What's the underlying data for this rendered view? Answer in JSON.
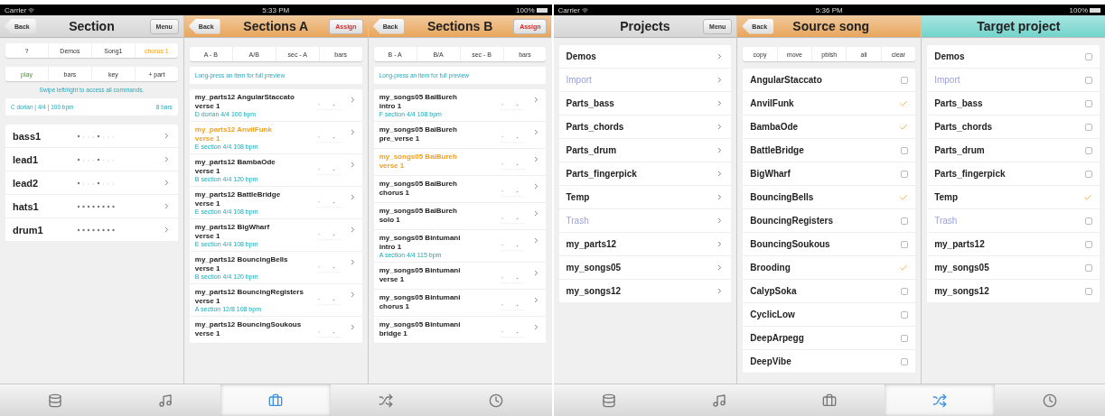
{
  "screens": [
    {
      "status_bar": {
        "carrier": "Carrier",
        "time": "5:33 PM",
        "battery": "100%"
      },
      "panes": [
        {
          "kind": "section",
          "header": {
            "back": "Back",
            "title": "Section",
            "action": {
              "label": "Menu",
              "kind": "menu"
            },
            "color": "#d6d6d6"
          },
          "breadcrumb": [
            {
              "label": "?",
              "selected": false
            },
            {
              "label": "Demos",
              "selected": false
            },
            {
              "label": "Song1",
              "selected": false
            },
            {
              "label": "chorus 1",
              "selected": true
            }
          ],
          "commands": [
            {
              "label": "play",
              "selected": true
            },
            {
              "label": "bars",
              "selected": false
            },
            {
              "label": "key",
              "selected": false
            },
            {
              "label": "+ part",
              "selected": false
            }
          ],
          "hint": "Swipe left/right to access all commands.",
          "info": {
            "scale": "C dorian | 4/4 | 100 bpm",
            "length": "8 bars"
          },
          "tracks": [
            {
              "name": "bass1",
              "kind": "sparse"
            },
            {
              "name": "lead1",
              "kind": "sparse"
            },
            {
              "name": "lead2",
              "kind": "sparse"
            },
            {
              "name": "hats1",
              "kind": "dense"
            },
            {
              "name": "drum1",
              "kind": "dense"
            }
          ]
        },
        {
          "kind": "sections",
          "header": {
            "back": "Back",
            "title": "Sections A",
            "action": {
              "label": "Assign",
              "kind": "assign"
            },
            "color": "#e8a65c"
          },
          "segments": [
            "A - B",
            "A/B",
            "sec - A",
            "bars"
          ],
          "hint": "Long-press an item for full preview",
          "items": [
            {
              "title": "my_parts12 AngularStaccato",
              "subtitle": "verse 1",
              "meta": "D dorian 4/4 100 bpm",
              "selected": false
            },
            {
              "title": "my_parts12 AnvilFunk",
              "subtitle": "verse 1",
              "meta": "E section 4/4 108 bpm",
              "selected": true
            },
            {
              "title": "my_parts12 BambaOde",
              "subtitle": "verse 1",
              "meta": "B section 4/4 120 bpm",
              "selected": false
            },
            {
              "title": "my_parts12 BattleBridge",
              "subtitle": "verse 1",
              "meta": "E section 4/4 108 bpm",
              "selected": false
            },
            {
              "title": "my_parts12 BigWharf",
              "subtitle": "verse 1",
              "meta": "E section 4/4 108 bpm",
              "selected": false
            },
            {
              "title": "my_parts12 BouncingBells",
              "subtitle": "verse 1",
              "meta": "B section 4/4 120 bpm",
              "selected": false
            },
            {
              "title": "my_parts12 BouncingRegisters",
              "subtitle": "verse 1",
              "meta": "A section 12/8 108 bpm",
              "selected": false
            },
            {
              "title": "my_parts12 BouncingSoukous",
              "subtitle": "verse 1",
              "selected": false
            }
          ]
        },
        {
          "kind": "sections",
          "header": {
            "back": "Back",
            "title": "Sections B",
            "action": {
              "label": "Assign",
              "kind": "assign"
            },
            "color": "#e8a65c"
          },
          "segments": [
            "B - A",
            "B/A",
            "sec - B",
            "bars"
          ],
          "hint": "Long-press an item for full preview",
          "items": [
            {
              "title": "my_songs05 BaiBureh",
              "subtitle": "intro 1",
              "meta": "F section 4/4 108 bpm",
              "selected": false
            },
            {
              "title": "my_songs05 BaiBureh",
              "subtitle": "pre_verse 1",
              "selected": false
            },
            {
              "title": "my_songs05 BaiBureh",
              "subtitle": "verse 1",
              "selected": true
            },
            {
              "title": "my_songs05 BaiBureh",
              "subtitle": "chorus 1",
              "selected": false
            },
            {
              "title": "my_songs05 BaiBureh",
              "subtitle": "solo 1",
              "selected": false
            },
            {
              "title": "my_songs05 Bintumani",
              "subtitle": "intro 1",
              "meta": "A section 4/4 115 bpm",
              "selected": false
            },
            {
              "title": "my_songs05 Bintumani",
              "subtitle": "verse 1",
              "selected": false
            },
            {
              "title": "my_songs05 Bintumani",
              "subtitle": "chorus 1",
              "selected": false
            },
            {
              "title": "my_songs05 Bintumani",
              "subtitle": "bridge 1",
              "selected": false
            }
          ]
        }
      ],
      "tab_bar": [
        {
          "kind": "stack",
          "selected": false
        },
        {
          "kind": "note",
          "selected": false
        },
        {
          "kind": "box",
          "selected": true
        },
        {
          "kind": "shuffle",
          "selected": false
        },
        {
          "kind": "clock",
          "selected": false
        }
      ]
    },
    {
      "status_bar": {
        "carrier": "Carrier",
        "time": "5:36 PM",
        "battery": "100%"
      },
      "panes": [
        {
          "kind": "projects",
          "header": {
            "title": "Projects",
            "action": {
              "label": "Menu",
              "kind": "menu"
            },
            "color": "#d6d6d6"
          },
          "items": [
            {
              "name": "Demos",
              "kind": "folder"
            },
            {
              "name": "Import",
              "kind": "system"
            },
            {
              "name": "Parts_bass",
              "kind": "folder"
            },
            {
              "name": "Parts_chords",
              "kind": "folder"
            },
            {
              "name": "Parts_drum",
              "kind": "folder"
            },
            {
              "name": "Parts_fingerpick",
              "kind": "folder"
            },
            {
              "name": "Temp",
              "kind": "folder"
            },
            {
              "name": "Trash",
              "kind": "system"
            },
            {
              "name": "my_parts12",
              "kind": "folder"
            },
            {
              "name": "my_songs05",
              "kind": "folder"
            },
            {
              "name": "my_songs12",
              "kind": "folder"
            }
          ]
        },
        {
          "kind": "source",
          "header": {
            "back": "Back",
            "title": "Source song",
            "color": "#e8a65c"
          },
          "tools": [
            "copy",
            "move",
            "pblsh",
            "all",
            "clear"
          ],
          "items": [
            {
              "name": "AngularStaccato",
              "checked": false
            },
            {
              "name": "AnvilFunk",
              "checked": true
            },
            {
              "name": "BambaOde",
              "checked": true
            },
            {
              "name": "BattleBridge",
              "checked": false
            },
            {
              "name": "BigWharf",
              "checked": false
            },
            {
              "name": "BouncingBells",
              "checked": true
            },
            {
              "name": "BouncingRegisters",
              "checked": false
            },
            {
              "name": "BouncingSoukous",
              "checked": false
            },
            {
              "name": "Brooding",
              "checked": true
            },
            {
              "name": "CalypSoka",
              "checked": false
            },
            {
              "name": "CyclicLow",
              "checked": false
            },
            {
              "name": "DeepArpegg",
              "checked": false
            },
            {
              "name": "DeepVibe",
              "checked": false
            }
          ]
        },
        {
          "kind": "target",
          "header": {
            "title": "Target project",
            "color": "#72d4cc"
          },
          "items": [
            {
              "name": "Demos",
              "kind": "folder",
              "checked": false
            },
            {
              "name": "Import",
              "kind": "system",
              "checked": false
            },
            {
              "name": "Parts_bass",
              "kind": "folder",
              "checked": false
            },
            {
              "name": "Parts_chords",
              "kind": "folder",
              "checked": false
            },
            {
              "name": "Parts_drum",
              "kind": "folder",
              "checked": false
            },
            {
              "name": "Parts_fingerpick",
              "kind": "folder",
              "checked": false
            },
            {
              "name": "Temp",
              "kind": "folder",
              "checked": true
            },
            {
              "name": "Trash",
              "kind": "system",
              "checked": false
            },
            {
              "name": "my_parts12",
              "kind": "folder",
              "checked": false
            },
            {
              "name": "my_songs05",
              "kind": "folder",
              "checked": false
            },
            {
              "name": "my_songs12",
              "kind": "folder",
              "checked": false
            }
          ]
        }
      ],
      "tab_bar": [
        {
          "kind": "stack",
          "selected": false
        },
        {
          "kind": "note",
          "selected": false
        },
        {
          "kind": "box",
          "selected": false
        },
        {
          "kind": "shuffle",
          "selected": true
        },
        {
          "kind": "clock",
          "selected": false
        }
      ]
    }
  ]
}
